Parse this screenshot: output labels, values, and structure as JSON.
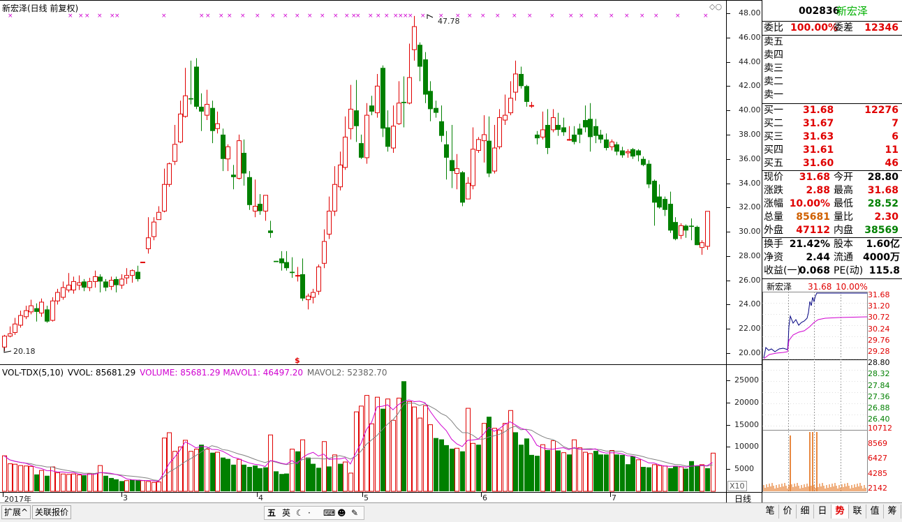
{
  "chart_title": "新宏泽(日线 前复权)",
  "price_axis": [
    "48.00",
    "46.00",
    "44.00",
    "42.00",
    "40.00",
    "38.00",
    "36.00",
    "34.00",
    "32.00",
    "30.00",
    "28.00",
    "26.00",
    "24.00",
    "22.00",
    "20.00"
  ],
  "volume_axis": [
    "25000",
    "20000",
    "15000",
    "10000",
    "5000"
  ],
  "volume_unit": "X10",
  "high_label": "47.78",
  "low_label": "20.18",
  "marker_symbol": "$",
  "vol_indicator": {
    "name": "VOL-TDX(5,10)",
    "vvol": "VVOL: 85681.29",
    "volume": "VOLUME: 85681.29",
    "mavol1": "MAVOL1: 46497.20",
    "mavol2": "MAVOL2: 52382.70"
  },
  "x_axis_labels": [
    "2017年",
    "3",
    "4",
    "5",
    "6",
    "7"
  ],
  "period_label": "日线",
  "quote": {
    "code": "002836",
    "name": "新宏泽",
    "weibi_label": "委比",
    "weibi": "100.00%",
    "weicha_label": "委差",
    "weicha": "12346",
    "sells": [
      {
        "label": "卖五",
        "price": "",
        "vol": ""
      },
      {
        "label": "卖四",
        "price": "",
        "vol": ""
      },
      {
        "label": "卖三",
        "price": "",
        "vol": ""
      },
      {
        "label": "卖二",
        "price": "",
        "vol": ""
      },
      {
        "label": "卖一",
        "price": "",
        "vol": ""
      }
    ],
    "buys": [
      {
        "label": "买一",
        "price": "31.68",
        "vol": "12276"
      },
      {
        "label": "买二",
        "price": "31.67",
        "vol": "7"
      },
      {
        "label": "买三",
        "price": "31.63",
        "vol": "6"
      },
      {
        "label": "买四",
        "price": "31.61",
        "vol": "11"
      },
      {
        "label": "买五",
        "price": "31.60",
        "vol": "46"
      }
    ],
    "stats": [
      {
        "l1": "现价",
        "v1": "31.68",
        "l2": "今开",
        "v2": "28.80"
      },
      {
        "l1": "涨跌",
        "v1": "2.88",
        "l2": "最高",
        "v2": "31.68"
      },
      {
        "l1": "涨幅",
        "v1": "10.00%",
        "l2": "最低",
        "v2": "28.52"
      },
      {
        "l1": "总量",
        "v1": "85681",
        "l2": "量比",
        "v2": "2.30"
      },
      {
        "l1": "外盘",
        "v1": "47112",
        "l2": "内盘",
        "v2": "38569"
      }
    ],
    "fund": [
      {
        "l1": "换手",
        "v1": "21.42%",
        "l2": "股本",
        "v2": "1.60亿"
      },
      {
        "l1": "净资",
        "v1": "2.44",
        "l2": "流通",
        "v2": "4000万"
      },
      {
        "l1": "收益(一)",
        "v1": "0.068",
        "l2": "PE(动)",
        "v2": "115.8"
      }
    ]
  },
  "mini_chart": {
    "name": "新宏泽",
    "price": "31.68",
    "pct": "10.00%",
    "price_ticks": [
      "31.68",
      "31.20",
      "30.72",
      "30.24",
      "29.76",
      "29.28",
      "28.80",
      "28.32",
      "27.84",
      "27.36",
      "26.88",
      "26.40"
    ],
    "vol_ticks": [
      "10712",
      "8569",
      "6427",
      "4285",
      "2142"
    ]
  },
  "bottom_left_tabs": [
    "扩展^",
    "关联报价"
  ],
  "ime": {
    "mode": "五",
    "lang": "英"
  },
  "right_tabs": [
    "笔",
    "价",
    "细",
    "日",
    "势",
    "联",
    "值",
    "筹"
  ],
  "colors": {
    "up": "#e00000",
    "down": "#008000",
    "ma1": "#d000d0",
    "ma2": "#808080",
    "accent_name": "#00b000"
  },
  "chart_data": {
    "type": "candlestick",
    "candles": [
      [
        20.5,
        21.4,
        21.5,
        20.18
      ],
      [
        21.4,
        21.6,
        22.2,
        21.3
      ],
      [
        21.7,
        22.4,
        22.9,
        21.5
      ],
      [
        22.3,
        23.1,
        23.5,
        22.1
      ],
      [
        23.0,
        23.5,
        23.9,
        22.8
      ],
      [
        23.4,
        23.9,
        24.4,
        23.2
      ],
      [
        23.7,
        23.4,
        24.1,
        22.6
      ],
      [
        23.3,
        24.2,
        24.5,
        23.0
      ],
      [
        23.6,
        22.6,
        23.9,
        22.5
      ],
      [
        22.7,
        24.3,
        24.6,
        22.6
      ],
      [
        24.3,
        25.0,
        25.3,
        24.0
      ],
      [
        24.6,
        25.4,
        25.9,
        24.4
      ],
      [
        25.2,
        25.6,
        26.6,
        25.0
      ],
      [
        25.2,
        25.9,
        26.3,
        24.9
      ],
      [
        25.6,
        25.8,
        26.4,
        25.2
      ],
      [
        25.9,
        25.4,
        26.1,
        25.1
      ],
      [
        25.4,
        25.9,
        26.2,
        25.1
      ],
      [
        25.9,
        26.3,
        26.8,
        25.4
      ],
      [
        26.3,
        25.9,
        26.5,
        25.0
      ],
      [
        25.9,
        25.4,
        26.1,
        25.1
      ],
      [
        25.5,
        26.0,
        26.3,
        25.2
      ],
      [
        26.1,
        25.6,
        26.3,
        25.0
      ],
      [
        25.6,
        26.1,
        26.5,
        25.3
      ],
      [
        26.2,
        26.4,
        27.0,
        25.7
      ],
      [
        26.4,
        26.8,
        26.9,
        25.8
      ],
      [
        26.7,
        26.1,
        27.2,
        25.9
      ],
      [
        27.5,
        27.5,
        27.5,
        27.5
      ],
      [
        28.6,
        29.5,
        31.2,
        28.2
      ],
      [
        29.6,
        30.8,
        31.2,
        29.3
      ],
      [
        31.0,
        31.6,
        32.1,
        31.0
      ],
      [
        31.7,
        33.9,
        35.2,
        31.6
      ],
      [
        33.9,
        35.6,
        35.7,
        33.7
      ],
      [
        35.8,
        37.2,
        38.8,
        35.5
      ],
      [
        37.4,
        39.7,
        40.8,
        37.3
      ],
      [
        39.5,
        41.2,
        43.5,
        39.4
      ],
      [
        41.0,
        40.9,
        44.1,
        40.5
      ],
      [
        43.6,
        40.3,
        44.3,
        40.1
      ],
      [
        40.3,
        39.9,
        41.4,
        38.3
      ],
      [
        39.6,
        40.5,
        41.7,
        39.2
      ],
      [
        40.2,
        38.3,
        40.8,
        37.3
      ],
      [
        38.5,
        38.9,
        39.9,
        38.1
      ],
      [
        38.0,
        36.0,
        38.5,
        35.0
      ],
      [
        36.0,
        37.0,
        37.2,
        35.0
      ],
      [
        34.7,
        34.5,
        35.5,
        33.5
      ],
      [
        34.4,
        37.5,
        38.0,
        34.3
      ],
      [
        36.5,
        34.8,
        37.6,
        33.8
      ],
      [
        34.5,
        32.2,
        35.0,
        31.8
      ],
      [
        31.7,
        32.1,
        34.3,
        31.2
      ],
      [
        32.3,
        31.7,
        33.1,
        31.4
      ],
      [
        31.7,
        33.0,
        33.0,
        30.9
      ],
      [
        30.1,
        29.9,
        30.9,
        29.5
      ],
      [
        27.6,
        27.5,
        27.6,
        27.5
      ],
      [
        27.8,
        27.4,
        28.4,
        26.8
      ],
      [
        27.5,
        27.0,
        28.4,
        26.8
      ],
      [
        26.7,
        26.6,
        27.9,
        26.2
      ],
      [
        26.4,
        26.4,
        27.1,
        25.9
      ],
      [
        26.5,
        24.5,
        27.8,
        24.3
      ],
      [
        24.4,
        24.7,
        24.9,
        23.6
      ],
      [
        24.6,
        25.0,
        25.3,
        24.1
      ],
      [
        25.1,
        27.1,
        27.3,
        24.8
      ],
      [
        27.4,
        29.2,
        30.2,
        27.0
      ],
      [
        29.8,
        31.7,
        32.9,
        29.4
      ],
      [
        31.7,
        33.9,
        35.4,
        31.3
      ],
      [
        33.7,
        35.5,
        36.6,
        33.4
      ],
      [
        35.3,
        37.8,
        39.5,
        35.1
      ],
      [
        38.5,
        40.1,
        42.1,
        37.6
      ],
      [
        40.0,
        38.7,
        42.5,
        37.4
      ],
      [
        37.3,
        36.1,
        38.0,
        36.0
      ],
      [
        36.1,
        39.6,
        40.6,
        35.6
      ],
      [
        40.4,
        39.9,
        41.2,
        39.6
      ],
      [
        39.8,
        42.0,
        43.0,
        39.4
      ],
      [
        43.5,
        38.5,
        43.7,
        37.8
      ],
      [
        38.6,
        37.0,
        40.0,
        36.6
      ],
      [
        36.9,
        38.7,
        40.4,
        36.5
      ],
      [
        38.9,
        40.6,
        42.4,
        38.8
      ],
      [
        40.7,
        40.6,
        42.8,
        38.6
      ],
      [
        40.6,
        42.7,
        45.5,
        40.5
      ],
      [
        45.0,
        46.9,
        47.78,
        44.1
      ],
      [
        45.4,
        43.6,
        45.6,
        42.4
      ],
      [
        44.2,
        41.3,
        44.8,
        40.6
      ],
      [
        41.6,
        40.1,
        42.4,
        39.1
      ],
      [
        40.2,
        39.8,
        40.8,
        39.4
      ],
      [
        39.1,
        37.9,
        40.4,
        37.4
      ],
      [
        37.2,
        36.1,
        38.3,
        34.3
      ],
      [
        35.9,
        35.0,
        38.8,
        33.6
      ],
      [
        34.8,
        35.2,
        36.4,
        33.5
      ],
      [
        34.9,
        32.4,
        35.0,
        32.1
      ],
      [
        32.7,
        34.0,
        34.5,
        33.0
      ],
      [
        33.8,
        36.8,
        38.6,
        33.5
      ],
      [
        36.7,
        37.6,
        37.8,
        36.5
      ],
      [
        37.5,
        38.0,
        39.6,
        35.7
      ],
      [
        37.5,
        34.8,
        39.5,
        34.5
      ],
      [
        35.0,
        36.9,
        38.8,
        34.8
      ],
      [
        37.0,
        39.4,
        40.1,
        36.8
      ],
      [
        39.2,
        39.6,
        41.3,
        38.8
      ],
      [
        39.8,
        41.0,
        42.4,
        39.6
      ],
      [
        41.5,
        43.0,
        44.1,
        40.8
      ],
      [
        43.0,
        42.0,
        43.6,
        41.8
      ],
      [
        42.0,
        40.7,
        42.1,
        40.3
      ],
      [
        40.4,
        40.4,
        40.7,
        40.2
      ],
      [
        38.0,
        37.7,
        38.3,
        37.2
      ],
      [
        37.8,
        38.4,
        39.9,
        37.6
      ],
      [
        38.8,
        36.9,
        40.1,
        36.4
      ],
      [
        38.4,
        39.4,
        40.1,
        38.2
      ],
      [
        38.8,
        38.4,
        39.8,
        37.9
      ],
      [
        38.6,
        38.2,
        39.4,
        37.9
      ],
      [
        37.6,
        37.6,
        38.7,
        37.5
      ],
      [
        38.0,
        37.4,
        38.7,
        37.2
      ],
      [
        38.5,
        38.0,
        38.9,
        37.3
      ],
      [
        39.2,
        38.6,
        40.4,
        38.2
      ],
      [
        39.3,
        37.8,
        40.6,
        36.6
      ],
      [
        38.7,
        37.9,
        39.3,
        37.3
      ],
      [
        38.0,
        37.6,
        38.4,
        37.3
      ],
      [
        37.6,
        36.9,
        38.1,
        36.7
      ],
      [
        37.0,
        37.4,
        37.6,
        36.7
      ],
      [
        37.2,
        36.6,
        37.4,
        36.3
      ],
      [
        36.7,
        36.3,
        37.0,
        36.1
      ],
      [
        36.5,
        36.6,
        36.8,
        36.1
      ],
      [
        36.8,
        36.2,
        36.9,
        36.0
      ],
      [
        36.7,
        36.3,
        36.8,
        35.8
      ],
      [
        36.0,
        35.5,
        36.2,
        35.4
      ],
      [
        35.6,
        33.9,
        35.9,
        33.6
      ],
      [
        34.2,
        32.4,
        34.3,
        30.5
      ],
      [
        32.9,
        32.0,
        33.9,
        31.9
      ],
      [
        32.7,
        31.8,
        32.9,
        31.3
      ],
      [
        32.3,
        30.1,
        33.3,
        29.9
      ],
      [
        30.8,
        29.4,
        31.2,
        29.3
      ],
      [
        29.7,
        30.5,
        30.7,
        29.4
      ],
      [
        30.5,
        30.1,
        30.6,
        29.5
      ],
      [
        30.5,
        30.4,
        31.1,
        29.3
      ],
      [
        30.4,
        28.9,
        30.5,
        28.9
      ],
      [
        28.7,
        29.1,
        29.3,
        28.1
      ],
      [
        28.8,
        31.68,
        31.68,
        28.52
      ]
    ],
    "volume_estimated": [
      [
        8000,
        1
      ],
      [
        6200,
        1
      ],
      [
        6100,
        1
      ],
      [
        5800,
        1
      ],
      [
        5700,
        1
      ],
      [
        5600,
        1
      ],
      [
        3800,
        0
      ],
      [
        4700,
        1
      ],
      [
        3500,
        0
      ],
      [
        5500,
        1
      ],
      [
        4200,
        1
      ],
      [
        3900,
        1
      ],
      [
        3800,
        1
      ],
      [
        3900,
        1
      ],
      [
        3700,
        1
      ],
      [
        3600,
        0
      ],
      [
        4000,
        1
      ],
      [
        4000,
        1
      ],
      [
        5800,
        1
      ],
      [
        3500,
        0
      ],
      [
        3000,
        0
      ],
      [
        2700,
        0
      ],
      [
        2300,
        0
      ],
      [
        2400,
        1
      ],
      [
        2600,
        0
      ],
      [
        2600,
        0
      ],
      [
        2400,
        1
      ],
      [
        2200,
        1
      ],
      [
        2000,
        1
      ],
      [
        2100,
        1
      ],
      [
        12000,
        1
      ],
      [
        13200,
        1
      ],
      [
        9000,
        1
      ],
      [
        10000,
        1
      ],
      [
        11500,
        1
      ],
      [
        9000,
        1
      ],
      [
        9500,
        1
      ],
      [
        10500,
        0
      ],
      [
        9500,
        1
      ],
      [
        8700,
        0
      ],
      [
        8800,
        1
      ],
      [
        7600,
        0
      ],
      [
        7300,
        0
      ],
      [
        6000,
        0
      ],
      [
        7200,
        1
      ],
      [
        6000,
        0
      ],
      [
        5500,
        0
      ],
      [
        5800,
        0
      ],
      [
        5200,
        0
      ],
      [
        5400,
        0
      ],
      [
        12700,
        1
      ],
      [
        4500,
        0
      ],
      [
        3900,
        0
      ],
      [
        4000,
        0
      ],
      [
        9500,
        1
      ],
      [
        9000,
        0
      ],
      [
        11600,
        1
      ],
      [
        7600,
        0
      ],
      [
        6200,
        0
      ],
      [
        5300,
        0
      ],
      [
        11200,
        1
      ],
      [
        5600,
        0
      ],
      [
        8200,
        1
      ],
      [
        6200,
        0
      ],
      [
        6600,
        1
      ],
      [
        4100,
        1
      ],
      [
        17900,
        1
      ],
      [
        19200,
        1
      ],
      [
        21600,
        1
      ],
      [
        15200,
        1
      ],
      [
        21200,
        1
      ],
      [
        18600,
        0
      ],
      [
        20800,
        1
      ],
      [
        16000,
        1
      ],
      [
        21000,
        1
      ],
      [
        24800,
        0
      ],
      [
        20200,
        1
      ],
      [
        19000,
        1
      ],
      [
        16500,
        1
      ],
      [
        19300,
        1
      ],
      [
        15000,
        1
      ],
      [
        12000,
        0
      ],
      [
        11700,
        0
      ],
      [
        10400,
        0
      ],
      [
        9600,
        0
      ],
      [
        9700,
        1
      ],
      [
        9000,
        0
      ],
      [
        18700,
        1
      ],
      [
        10800,
        1
      ],
      [
        10500,
        0
      ],
      [
        15300,
        1
      ],
      [
        16800,
        0
      ],
      [
        14200,
        1
      ],
      [
        13800,
        1
      ],
      [
        15300,
        1
      ],
      [
        18200,
        1
      ],
      [
        13300,
        0
      ],
      [
        10500,
        0
      ],
      [
        11900,
        0
      ],
      [
        8200,
        0
      ],
      [
        8000,
        0
      ],
      [
        10500,
        1
      ],
      [
        9300,
        0
      ],
      [
        11400,
        1
      ],
      [
        9200,
        0
      ],
      [
        8700,
        1
      ],
      [
        8300,
        0
      ],
      [
        11600,
        1
      ],
      [
        9800,
        1
      ],
      [
        8800,
        1
      ],
      [
        8500,
        1
      ],
      [
        9100,
        0
      ],
      [
        8300,
        0
      ],
      [
        8300,
        0
      ],
      [
        9200,
        1
      ],
      [
        8300,
        0
      ],
      [
        8200,
        0
      ],
      [
        6100,
        0
      ],
      [
        7900,
        0
      ],
      [
        7100,
        1
      ],
      [
        5500,
        0
      ],
      [
        5400,
        0
      ],
      [
        6000,
        1
      ],
      [
        5800,
        1
      ],
      [
        5700,
        1
      ],
      [
        5200,
        0
      ],
      [
        5700,
        0
      ],
      [
        5500,
        1
      ],
      [
        5100,
        0
      ],
      [
        6800,
        0
      ],
      [
        5800,
        0
      ],
      [
        6000,
        1
      ],
      [
        5200,
        0
      ],
      [
        8600,
        1
      ]
    ],
    "marker_rows": "stock event markers shown as × at top"
  }
}
